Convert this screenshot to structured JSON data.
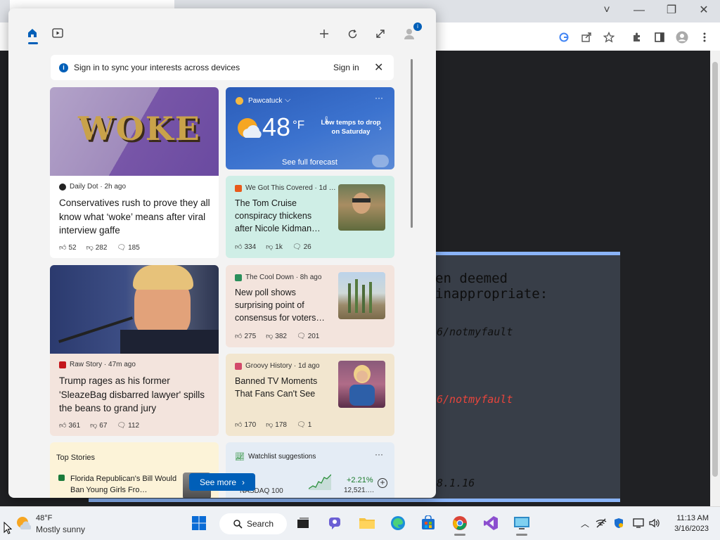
{
  "browser": {
    "window_controls": [
      "˅",
      "—",
      "❐",
      "✕"
    ]
  },
  "dialog": {
    "title": "en deemed inappropriate:",
    "link1": "6/notmyfault",
    "link2": "6/notmyfault",
    "version": "8.1.16"
  },
  "signin": {
    "message": "Sign in to sync your interests across devices",
    "link": "Sign in"
  },
  "cards": {
    "woke": {
      "image_text": "WOKE",
      "source": "Daily Dot · 2h ago",
      "headline": "Conservatives rush to prove they all know what ‘woke’ means after viral interview gaffe",
      "likes": "52",
      "dislikes": "282",
      "comments": "185"
    },
    "weather": {
      "location": "Pawcatuck",
      "temp": "48",
      "unit": "°F",
      "note": "Low temps to drop on Saturday",
      "forecast_link": "See full forecast"
    },
    "cruise": {
      "source": "We Got This Covered · 1d …",
      "headline": "The Tom Cruise conspiracy thickens after Nicole Kidman…",
      "likes": "334",
      "dislikes": "1k",
      "comments": "26"
    },
    "trump": {
      "source": "Raw Story · 47m ago",
      "headline": "Trump rages as his former 'SleazeBag disbarred lawyer' spills the beans to grand jury",
      "likes": "361",
      "dislikes": "67",
      "comments": "112"
    },
    "poll": {
      "source": "The Cool Down · 8h ago",
      "headline": "New poll shows surprising point of consensus for voters…",
      "likes": "275",
      "dislikes": "382",
      "comments": "201"
    },
    "tv": {
      "source": "Groovy History · 1d ago",
      "headline": "Banned TV Moments That Fans Can't See",
      "likes": "170",
      "dislikes": "178",
      "comments": "1"
    },
    "top_stories": {
      "label": "Top Stories",
      "headline": "Florida Republican's Bill Would Ban Young Girls Fro…"
    },
    "watchlist": {
      "label": "Watchlist suggestions",
      "index": "NASDAQ 100",
      "change": "+2.21%",
      "value": "12,521.…"
    }
  },
  "see_more": "See more",
  "taskbar": {
    "weather_temp": "48°F",
    "weather_desc": "Mostly sunny",
    "search_label": "Search",
    "time": "11:13 AM",
    "date": "3/16/2023"
  },
  "colors": {
    "accent": "#005fb8",
    "dialog_border": "#8ab4f8",
    "link_red": "#e8453c"
  }
}
